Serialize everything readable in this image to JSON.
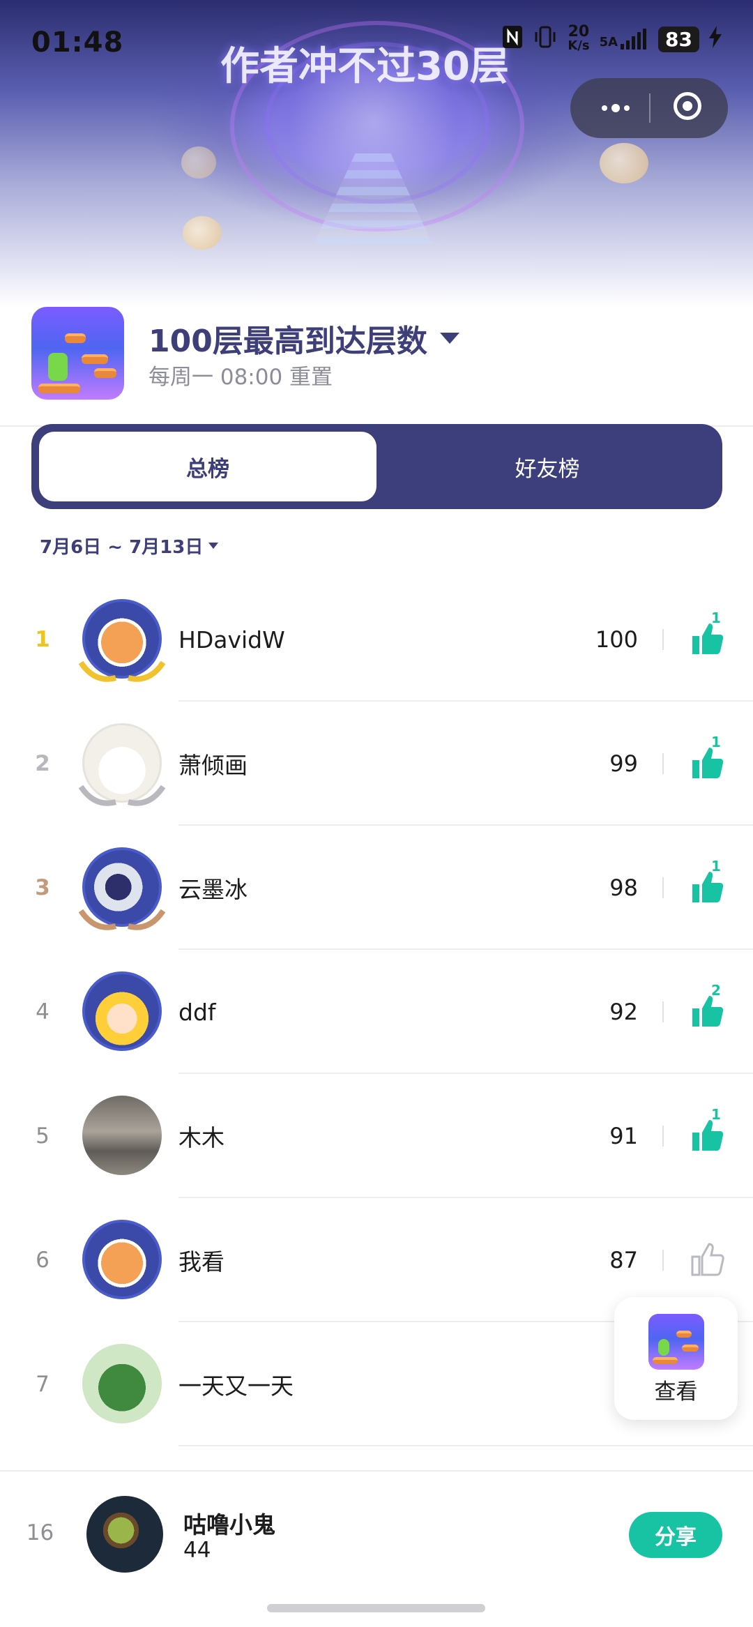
{
  "status_bar": {
    "time": "01:48",
    "net_speed_top": "20",
    "net_speed_unit": "K/s",
    "signal_label": "5A",
    "battery": "83"
  },
  "banner": {
    "game_title": "作者冲不过30层"
  },
  "capsule": {
    "more_icon": "more-dots-icon",
    "close_icon": "target-circle-icon"
  },
  "header": {
    "title": "100层最高到达层数",
    "subtitle": "每周一 08:00 重置"
  },
  "tabs": [
    {
      "label": "总榜",
      "active": true
    },
    {
      "label": "好友榜",
      "active": false
    }
  ],
  "date_range": "7月6日 ~ 7月13日",
  "leaderboard": [
    {
      "rank": "1",
      "name": "HDavidW",
      "score": "100",
      "likes": "1",
      "liked": true
    },
    {
      "rank": "2",
      "name": "萧倾画",
      "score": "99",
      "likes": "1",
      "liked": true
    },
    {
      "rank": "3",
      "name": "云墨冰",
      "score": "98",
      "likes": "1",
      "liked": true
    },
    {
      "rank": "4",
      "name": "ddf",
      "score": "92",
      "likes": "2",
      "liked": true
    },
    {
      "rank": "5",
      "name": "木木",
      "score": "91",
      "likes": "1",
      "liked": true
    },
    {
      "rank": "6",
      "name": "我看",
      "score": "87",
      "likes": "",
      "liked": false
    },
    {
      "rank": "7",
      "name": "一天又一天",
      "score": "",
      "likes": "",
      "liked": false
    }
  ],
  "float_card": {
    "label": "查看"
  },
  "me": {
    "rank": "16",
    "name": "咕噜小鬼",
    "score": "44",
    "share_label": "分享"
  },
  "colors": {
    "accent": "#3d3e7c",
    "like": "#18c3a4",
    "gold": "#f0c419"
  }
}
